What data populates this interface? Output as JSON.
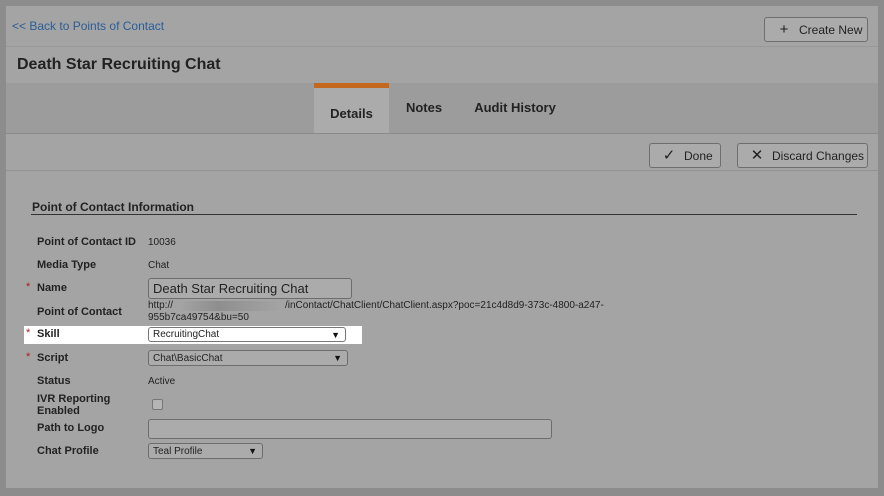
{
  "topbar": {
    "back_label": "<< Back to Points of Contact",
    "create_label": "Create New",
    "create_icon": "plus-icon"
  },
  "title": "Death Star Recruiting Chat",
  "tabs": [
    {
      "label": "Details",
      "active": true
    },
    {
      "label": "Notes",
      "active": false
    },
    {
      "label": "Audit History",
      "active": false
    }
  ],
  "actions": {
    "done_label": "Done",
    "done_icon": "check-icon",
    "discard_label": "Discard Changes",
    "discard_icon": "x-icon"
  },
  "section_title": "Point of Contact Information",
  "fields": {
    "poc_id": {
      "label": "Point of Contact ID",
      "value": "10036"
    },
    "media_type": {
      "label": "Media Type",
      "value": "Chat"
    },
    "name": {
      "label": "Name",
      "value": "Death Star Recruiting Chat",
      "required": "*"
    },
    "poc": {
      "label": "Point of Contact",
      "value_prefix": "http://",
      "value_mid": "/inContact/ChatClient/ChatClient.aspx?poc=21c4d8d9-373c-4800-a247-",
      "value_line2": "955b7ca49754&bu=50"
    },
    "skill": {
      "label": "Skill",
      "value": "RecruitingChat",
      "required": "*"
    },
    "script": {
      "label": "Script",
      "value": "Chat\\BasicChat",
      "required": "*"
    },
    "status": {
      "label": "Status",
      "value": "Active"
    },
    "ivr": {
      "label_line1": "IVR Reporting",
      "label_line2": "Enabled",
      "checked": false
    },
    "logo": {
      "label": "Path to Logo",
      "value": ""
    },
    "chat_profile": {
      "label": "Chat Profile",
      "value": "Teal Profile"
    }
  },
  "colors": {
    "accent_tab": "#c4681f",
    "link": "#2a5d96",
    "required": "#a12121"
  }
}
